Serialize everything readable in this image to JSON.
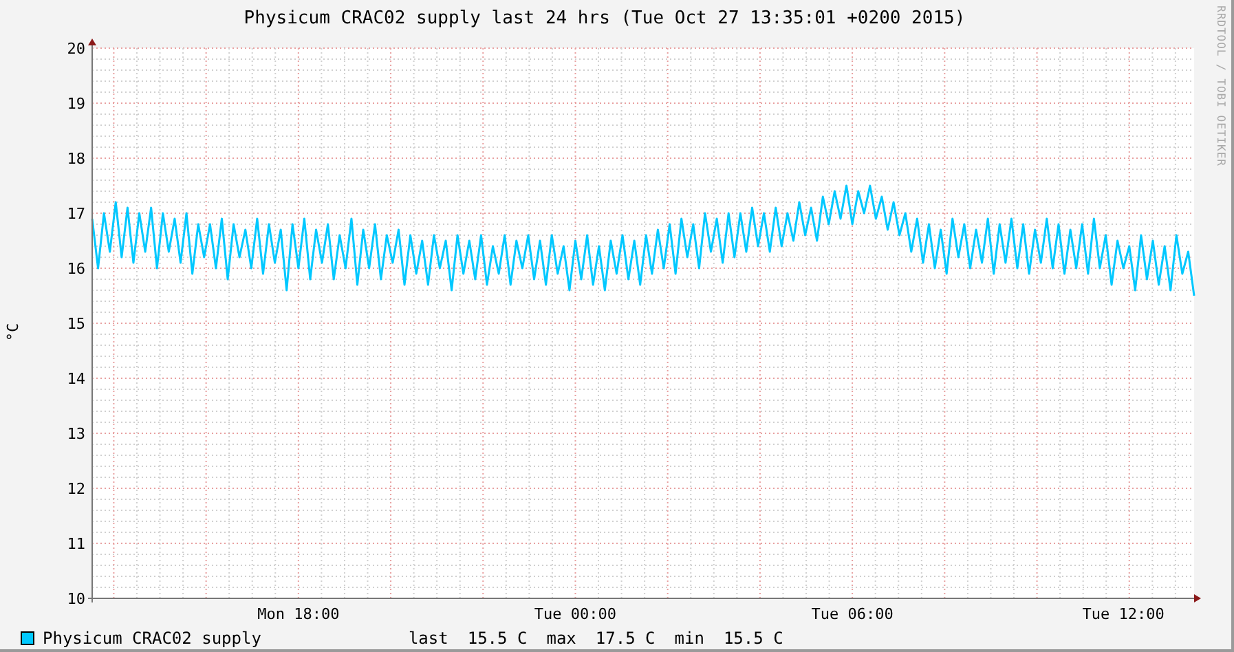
{
  "title": "Physicum CRAC02 supply last 24 hrs (Tue Oct 27 13:35:01 +0200 2015)",
  "credit": "RRDTOOL / TOBI OETIKER",
  "chart_data": {
    "type": "line",
    "ylabel": "°C",
    "grid": true,
    "ylim": [
      10,
      20
    ],
    "yticks": [
      10,
      11,
      12,
      13,
      14,
      15,
      16,
      17,
      18,
      19,
      20
    ],
    "categories": [
      null,
      null,
      null,
      null,
      null,
      null,
      null,
      null,
      null,
      null,
      null,
      null,
      null,
      null,
      null,
      null,
      null,
      null,
      null,
      null,
      null,
      null,
      null,
      null,
      null,
      null,
      null,
      null,
      null,
      null,
      null,
      null,
      null,
      null,
      null,
      "Mon 18:00",
      null,
      null,
      null,
      null,
      null,
      null,
      null,
      null,
      null,
      null,
      null,
      null,
      null,
      null,
      null,
      null,
      null,
      null,
      null,
      null,
      null,
      null,
      null,
      null,
      null,
      null,
      null,
      null,
      null,
      null,
      null,
      null,
      null,
      null,
      null,
      null,
      null,
      null,
      null,
      null,
      null,
      null,
      null,
      null,
      null,
      null,
      "Tue 00:00",
      null,
      null,
      null,
      null,
      null,
      null,
      null,
      null,
      null,
      null,
      null,
      null,
      null,
      null,
      null,
      null,
      null,
      null,
      null,
      null,
      null,
      null,
      null,
      null,
      null,
      null,
      null,
      null,
      null,
      null,
      null,
      null,
      null,
      null,
      null,
      null,
      null,
      null,
      null,
      null,
      null,
      null,
      null,
      null,
      null,
      null,
      "Tue 06:00",
      null,
      null,
      null,
      null,
      null,
      null,
      null,
      null,
      null,
      null,
      null,
      null,
      null,
      null,
      null,
      null,
      null,
      null,
      null,
      null,
      null,
      null,
      null,
      null,
      null,
      null,
      null,
      null,
      null,
      null,
      null,
      null,
      null,
      null,
      null,
      null,
      null,
      null,
      null,
      null,
      null,
      null,
      null,
      null,
      null,
      "Tue 12:00",
      null,
      null,
      null,
      null,
      null,
      null,
      null,
      null,
      null,
      null,
      null,
      null
    ],
    "series": [
      {
        "name": "Physicum CRAC02 supply",
        "color": "#00c8ff",
        "values": [
          16.9,
          16.0,
          17.0,
          16.3,
          17.2,
          16.2,
          17.1,
          16.1,
          17.0,
          16.3,
          17.1,
          16.0,
          17.0,
          16.3,
          16.9,
          16.1,
          17.0,
          15.9,
          16.8,
          16.2,
          16.8,
          16.0,
          16.9,
          15.8,
          16.8,
          16.2,
          16.7,
          16.0,
          16.9,
          15.9,
          16.8,
          16.1,
          16.7,
          15.6,
          16.8,
          16.0,
          16.9,
          15.8,
          16.7,
          16.1,
          16.8,
          15.8,
          16.6,
          16.0,
          16.9,
          15.7,
          16.7,
          16.0,
          16.8,
          15.8,
          16.6,
          16.1,
          16.7,
          15.7,
          16.6,
          15.9,
          16.5,
          15.7,
          16.6,
          16.0,
          16.5,
          15.6,
          16.6,
          15.9,
          16.5,
          15.8,
          16.6,
          15.7,
          16.4,
          15.9,
          16.6,
          15.7,
          16.5,
          16.0,
          16.6,
          15.8,
          16.5,
          15.7,
          16.6,
          15.9,
          16.4,
          15.6,
          16.5,
          15.8,
          16.6,
          15.7,
          16.4,
          15.6,
          16.5,
          15.9,
          16.6,
          15.8,
          16.5,
          15.7,
          16.6,
          15.9,
          16.7,
          16.0,
          16.8,
          15.9,
          16.9,
          16.2,
          16.8,
          16.0,
          17.0,
          16.3,
          16.9,
          16.1,
          17.0,
          16.2,
          17.0,
          16.3,
          17.1,
          16.4,
          17.0,
          16.3,
          17.1,
          16.4,
          17.0,
          16.5,
          17.2,
          16.6,
          17.1,
          16.5,
          17.3,
          16.8,
          17.4,
          16.9,
          17.5,
          16.8,
          17.4,
          17.0,
          17.5,
          16.9,
          17.3,
          16.7,
          17.2,
          16.6,
          17.0,
          16.3,
          16.9,
          16.1,
          16.8,
          16.0,
          16.7,
          15.9,
          16.9,
          16.2,
          16.8,
          16.0,
          16.7,
          16.1,
          16.9,
          15.9,
          16.8,
          16.1,
          16.9,
          16.0,
          16.8,
          15.9,
          16.7,
          16.1,
          16.9,
          16.0,
          16.8,
          15.9,
          16.7,
          16.0,
          16.8,
          15.9,
          16.9,
          16.0,
          16.6,
          15.7,
          16.5,
          16.0,
          16.4,
          15.6,
          16.6,
          15.8,
          16.5,
          15.7,
          16.4,
          15.6,
          16.6,
          15.9,
          16.3,
          15.5
        ]
      }
    ]
  },
  "legend": {
    "color": "#00c8ff",
    "stats": [
      {
        "label": "last",
        "value": "15.5 C"
      },
      {
        "label": "max",
        "value": "17.5 C"
      },
      {
        "label": "min",
        "value": "15.5 C"
      }
    ]
  }
}
